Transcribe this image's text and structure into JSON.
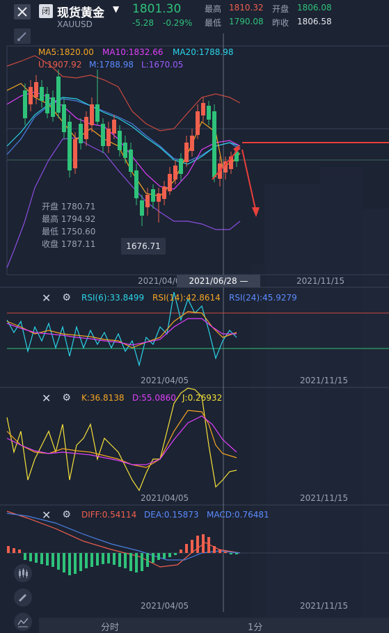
{
  "header": {
    "badge": "闭",
    "title": "现货黄金",
    "code": "XAUUSD",
    "price": "1801.30",
    "change": "-5.28",
    "change_pct": "-0.29%",
    "high_label": "最高",
    "high_value": "1810.32",
    "open_label": "开盘",
    "open_value": "1806.08",
    "low_label": "最低",
    "low_value": "1790.08",
    "prev_label": "昨收",
    "prev_value": "1806.58"
  },
  "main_chart": {
    "ma5": "MA5:1820.00",
    "ma10": "MA10:1832.66",
    "ma20": "MA20:1788.98",
    "boll_u": "U:1907.92",
    "boll_m": "M:1788.98",
    "boll_l": "L:1670.05",
    "open": "开盘 1780.71",
    "high": "最高 1794.92",
    "low": "最低 1750.60",
    "close": "收盘 1787.11",
    "marker": "1676.71",
    "date_left": "2021/04/05",
    "date_cursor": "2021/06/28 —",
    "date_right": "2021/11/15"
  },
  "rsi": {
    "rsi6": "RSI(6):33.8499",
    "rsi14": "RSI(14):42.8614",
    "rsi24": "RSI(24):45.9279",
    "date_left": "2021/04/05",
    "date_right": "2021/11/15"
  },
  "kdj": {
    "k": "K:36.8138",
    "d": "D:55.0860",
    "j": "J:0.26932",
    "date_left": "2021/04/05",
    "date_right": "2021/11/15"
  },
  "macd": {
    "diff": "DIFF:0.54114",
    "dea": "DEA:0.15873",
    "macd": "MACD:0.76481",
    "date_left": "2021/04/05",
    "date_right": "2021/11/15"
  },
  "tabs": {
    "timeshare": "分时",
    "one_min": "1分"
  },
  "colors": {
    "background": "#1c2333",
    "up": "#f0604d",
    "down": "#2fc27a",
    "ma5": "#f5a623",
    "ma10": "#e040fb",
    "ma20": "#2bd4e8",
    "boll_u": "#f0604d",
    "boll_m": "#5b8cff",
    "boll_l": "#9b5cff"
  }
}
